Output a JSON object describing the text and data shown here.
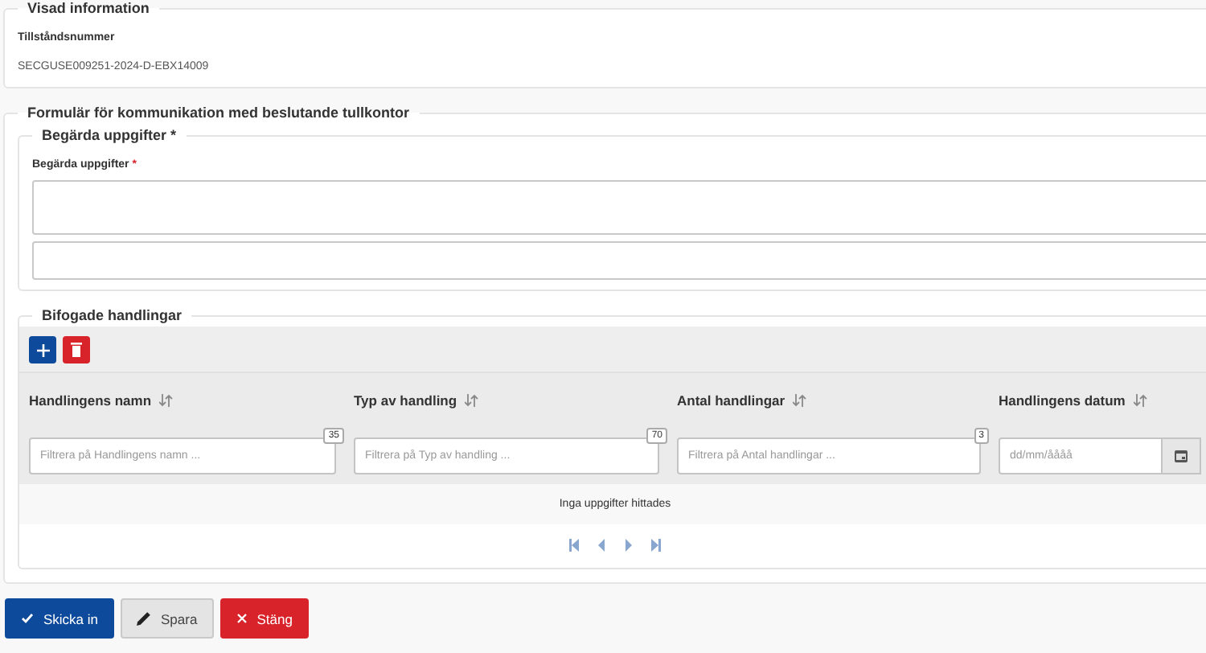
{
  "info": {
    "legend": "Visad information",
    "label": "Tillståndsnummer",
    "value": "SECGUSE009251-2024-D-EBX14009"
  },
  "form": {
    "legend": "Formulär för kommunikation med beslutande tullkontor",
    "requested": {
      "legend": "Begärda uppgifter *",
      "label": "Begärda uppgifter",
      "required_mark": "*"
    },
    "attachments": {
      "legend": "Bifogade handlingar",
      "columns": [
        {
          "title": "Handlingens namn",
          "kind": "text",
          "placeholder": "Filtrera på Handlingens namn ...",
          "counter": "35"
        },
        {
          "title": "Typ av handling",
          "kind": "text",
          "placeholder": "Filtrera på Typ av handling ...",
          "counter": "70"
        },
        {
          "title": "Antal handlingar",
          "kind": "text",
          "placeholder": "Filtrera på Antal handlingar ...",
          "counter": "3"
        },
        {
          "title": "Handlingens datum",
          "kind": "date",
          "placeholder": "dd/mm/åååå"
        }
      ],
      "empty_message": "Inga uppgifter hittades",
      "pagination": {
        "disabled": true
      }
    }
  },
  "buttons": [
    {
      "label": "Skicka in",
      "kind": "submit"
    },
    {
      "label": "Spara",
      "kind": "save"
    },
    {
      "label": "Stäng",
      "kind": "close"
    }
  ]
}
